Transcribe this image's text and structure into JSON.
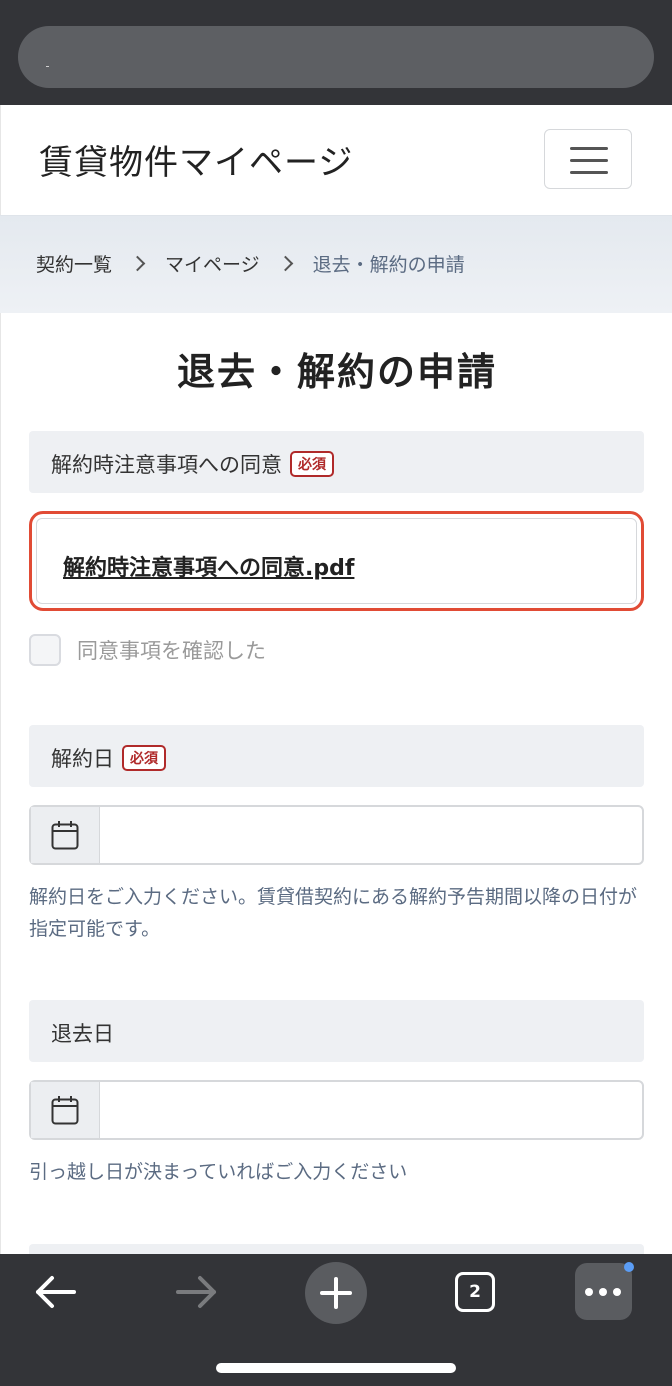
{
  "browser": {
    "tab_count": "2"
  },
  "header": {
    "site_title": "賃貸物件マイページ"
  },
  "breadcrumb": {
    "items": [
      "契約一覧",
      "マイページ",
      "退去・解約の申請"
    ]
  },
  "page": {
    "title": "退去・解約の申請"
  },
  "consent": {
    "label": "解約時注意事項への同意",
    "required_badge": "必須",
    "pdf_link": "解約時注意事項への同意.pdf",
    "checkbox_label": "同意事項を確認した",
    "checked": false
  },
  "cancel_date": {
    "label": "解約日",
    "required_badge": "必須",
    "value": "",
    "help": "解約日をご入力ください。賃貸借契約にある解約予告期間以降の日付が指定可能です。"
  },
  "moveout_date": {
    "label": "退去日",
    "value": "",
    "help": "引っ越し日が決まっていればご入力ください"
  },
  "colors": {
    "accent_highlight": "#e14b35",
    "required": "#b02a2a",
    "help_text": "#5b6b82",
    "browser_chrome": "#333438"
  }
}
